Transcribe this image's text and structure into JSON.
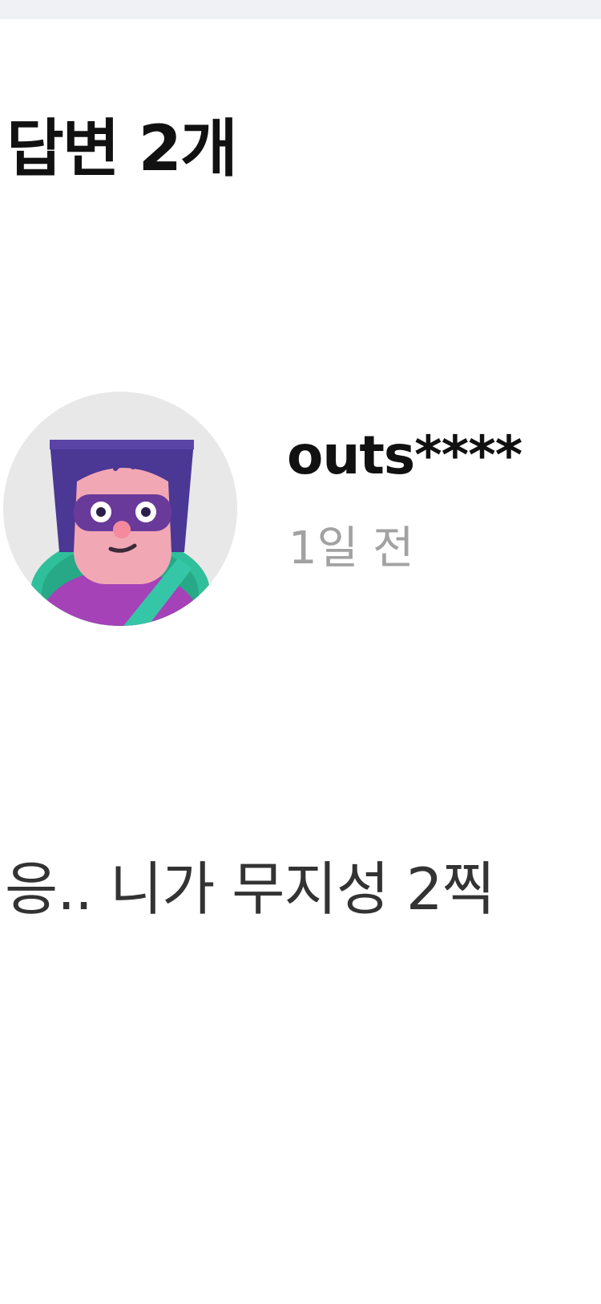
{
  "header": {
    "title": "답변 2개"
  },
  "answer": {
    "author": "outs****",
    "time": "1일 전",
    "text": "응.. 니가 무지성 2찍",
    "avatar_icon": "masked-hero-avatar"
  },
  "colors": {
    "background": "#ffffff",
    "top_strip": "#eff1f4",
    "primary_text": "#111111",
    "secondary_text": "#a2a2a2",
    "avatar_bg": "#e8e8e8",
    "avatar_hat": "#4b3794",
    "avatar_body": "#a542b8",
    "avatar_accent": "#2fbf9a"
  }
}
